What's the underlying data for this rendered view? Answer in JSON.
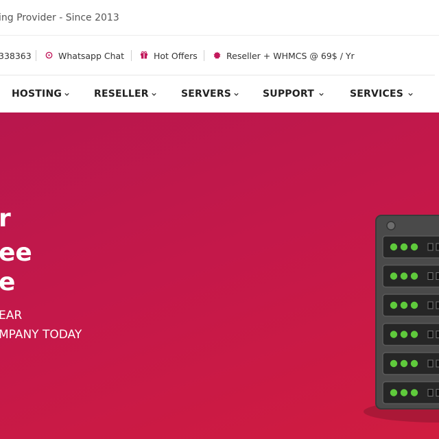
{
  "header": {
    "tagline": "ing Provider - Since 2013"
  },
  "topbar": {
    "phone": "338363",
    "whatsapp_label": "Whatsapp Chat",
    "offers_label": "Hot Offers",
    "reseller_label": "Reseller + WHMCS @ 69$ / Yr",
    "icons": [
      "whatsapp-icon",
      "gift-icon",
      "badge-icon"
    ],
    "accent_color": "#c2185b"
  },
  "nav": {
    "items": [
      {
        "label": "HOSTING"
      },
      {
        "label": "RESELLER"
      },
      {
        "label": "SERVERS"
      },
      {
        "label": "SUPPORT"
      },
      {
        "label": "SERVICES"
      }
    ]
  },
  "hero": {
    "line1": "r",
    "line2": "ee",
    "line3": "e",
    "line4": "EAR",
    "line5": "MPANY TODAY",
    "colors": {
      "start": "#b8174d",
      "end": "#d01c40"
    }
  }
}
